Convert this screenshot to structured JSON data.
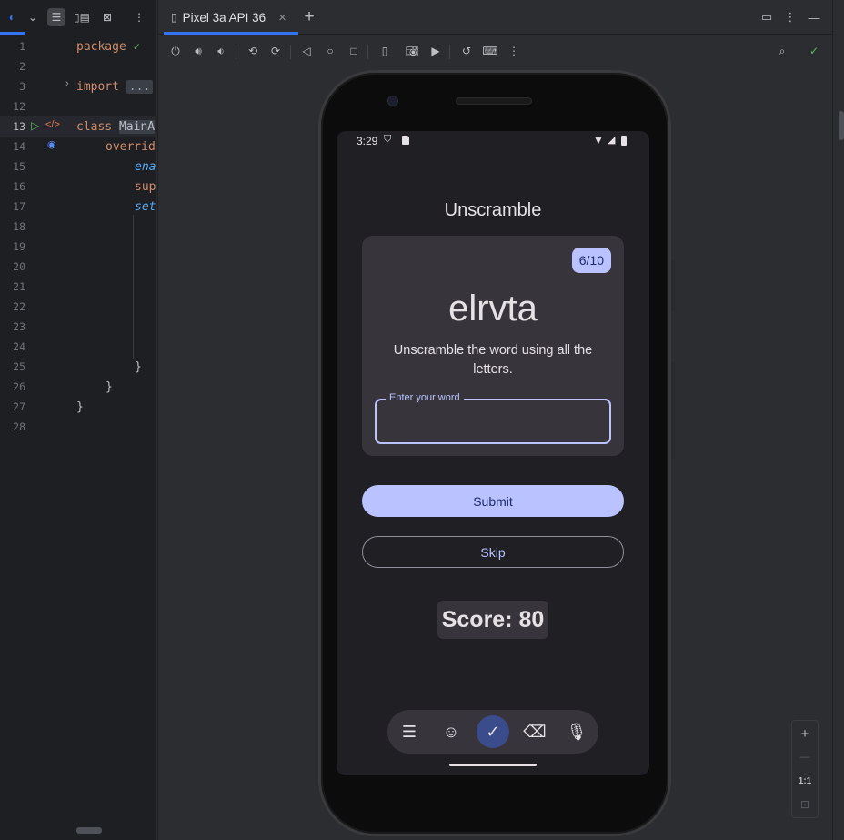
{
  "editor": {
    "line_numbers": [
      "1",
      "2",
      "3",
      "12",
      "13",
      "14",
      "15",
      "16",
      "17",
      "18",
      "19",
      "20",
      "21",
      "22",
      "23",
      "24",
      "25",
      "26",
      "27",
      "28"
    ],
    "code": {
      "package_kw": "package",
      "import_kw": "import",
      "import_fold": "...",
      "class_kw": "class",
      "class_name": "MainA",
      "override_kw": "overrid",
      "line15": "ena",
      "line16": "sup",
      "line17": "set",
      "brace_inner": "}",
      "brace_mid": "}",
      "brace_outer": "}"
    },
    "icons": {
      "run": "run-gutter-icon",
      "compose": "compose-preview-icon",
      "override": "override-marker-icon",
      "check": "inspection-ok-icon"
    }
  },
  "device_panel": {
    "tab_label": "Pixel 3a API 36",
    "tab_close": "×",
    "add_tab": "+",
    "zoom_in": "+",
    "zoom_out": "—",
    "zoom_ratio": "1:1"
  },
  "phone": {
    "status_time": "3:29",
    "app_title": "Unscramble",
    "word_count": "6/10",
    "scrambled_word": "elrvta",
    "instructions": "Unscramble the word using all the letters.",
    "input_label": "Enter your word",
    "input_value": "",
    "submit_label": "Submit",
    "skip_label": "Skip",
    "score_text": "Score: 80"
  },
  "colors": {
    "accent": "#3574f0",
    "primary_container": "#bac3ff",
    "on_primary": "#1c2a6b",
    "surface": "#201f24",
    "card": "#37353b"
  }
}
